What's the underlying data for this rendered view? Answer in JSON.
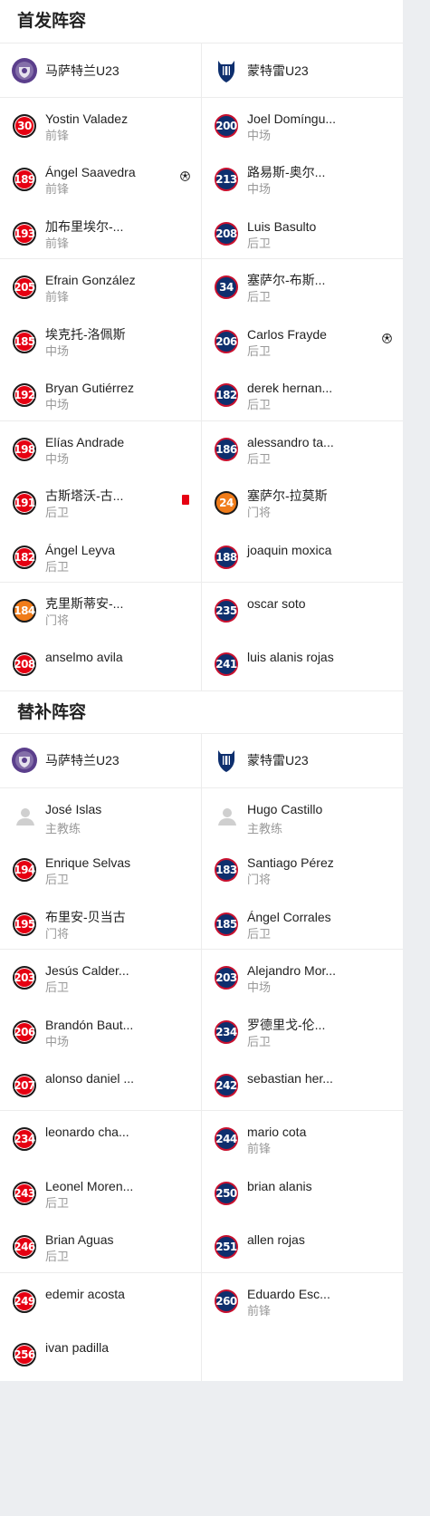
{
  "starting": {
    "title": "首发阵容",
    "home_team": "马萨特兰U23",
    "away_team": "蒙特雷U23",
    "home": [
      {
        "num": "30",
        "name": "Yostin Valadez",
        "pos": "前锋",
        "badge": "red"
      },
      {
        "num": "189",
        "name": "Ángel Saavedra",
        "pos": "前锋",
        "badge": "red",
        "event": "goal-icon"
      },
      {
        "num": "193",
        "name": "加布里埃尔-...",
        "pos": "前锋",
        "badge": "red"
      },
      {
        "num": "205",
        "name": "Efrain González",
        "pos": "前锋",
        "badge": "red"
      },
      {
        "num": "185",
        "name": "埃克托-洛佩斯",
        "pos": "中场",
        "badge": "red"
      },
      {
        "num": "192",
        "name": "Bryan Gutiérrez",
        "pos": "中场",
        "badge": "red"
      },
      {
        "num": "198",
        "name": "Elías Andrade",
        "pos": "中场",
        "badge": "red"
      },
      {
        "num": "191",
        "name": "古斯塔沃-古...",
        "pos": "后卫",
        "badge": "red",
        "event": "red-card-icon"
      },
      {
        "num": "182",
        "name": "Ángel Leyva",
        "pos": "后卫",
        "badge": "red"
      },
      {
        "num": "184",
        "name": "克里斯蒂安-...",
        "pos": "门将",
        "badge": "orange"
      },
      {
        "num": "208",
        "name": "anselmo avila",
        "pos": "",
        "badge": "red"
      }
    ],
    "away": [
      {
        "num": "200",
        "name": "Joel Domíngu...",
        "pos": "中场",
        "badge": "blue"
      },
      {
        "num": "213",
        "name": "路易斯-奥尔...",
        "pos": "中场",
        "badge": "blue"
      },
      {
        "num": "208",
        "name": "Luis Basulto",
        "pos": "后卫",
        "badge": "blue"
      },
      {
        "num": "34",
        "name": "塞萨尔-布斯...",
        "pos": "后卫",
        "badge": "blue"
      },
      {
        "num": "206",
        "name": "Carlos Frayde",
        "pos": "后卫",
        "badge": "blue",
        "event": "goal-icon"
      },
      {
        "num": "182",
        "name": "derek hernan...",
        "pos": "后卫",
        "badge": "blue"
      },
      {
        "num": "186",
        "name": "alessandro ta...",
        "pos": "后卫",
        "badge": "blue"
      },
      {
        "num": "24",
        "name": "塞萨尔-拉莫斯",
        "pos": "门将",
        "badge": "orange"
      },
      {
        "num": "188",
        "name": "joaquin moxica",
        "pos": "",
        "badge": "blue"
      },
      {
        "num": "235",
        "name": "oscar soto",
        "pos": "",
        "badge": "blue"
      },
      {
        "num": "241",
        "name": "luis alanis rojas",
        "pos": "",
        "badge": "blue"
      }
    ]
  },
  "subs": {
    "title": "替补阵容",
    "home_team": "马萨特兰U23",
    "away_team": "蒙特雷U23",
    "home_coach": {
      "name": "José Islas",
      "role": "主教练"
    },
    "away_coach": {
      "name": "Hugo Castillo",
      "role": "主教练"
    },
    "home": [
      {
        "num": "194",
        "name": "Enrique Selvas",
        "pos": "后卫",
        "badge": "red"
      },
      {
        "num": "195",
        "name": "布里安-贝当古",
        "pos": "门将",
        "badge": "red"
      },
      {
        "num": "203",
        "name": "Jesús Calder...",
        "pos": "后卫",
        "badge": "red"
      },
      {
        "num": "206",
        "name": "Brandón Baut...",
        "pos": "中场",
        "badge": "red"
      },
      {
        "num": "207",
        "name": "alonso daniel ...",
        "pos": "",
        "badge": "red"
      },
      {
        "num": "234",
        "name": "leonardo cha...",
        "pos": "",
        "badge": "red"
      },
      {
        "num": "243",
        "name": "Leonel Moren...",
        "pos": "后卫",
        "badge": "red"
      },
      {
        "num": "246",
        "name": "Brian Aguas",
        "pos": "后卫",
        "badge": "red"
      },
      {
        "num": "249",
        "name": "edemir acosta",
        "pos": "",
        "badge": "red"
      },
      {
        "num": "256",
        "name": "ivan padilla",
        "pos": "",
        "badge": "red"
      }
    ],
    "away": [
      {
        "num": "183",
        "name": "Santiago Pérez",
        "pos": "门将",
        "badge": "blue"
      },
      {
        "num": "185",
        "name": "Ángel Corrales",
        "pos": "后卫",
        "badge": "blue"
      },
      {
        "num": "203",
        "name": "Alejandro Mor...",
        "pos": "中场",
        "badge": "blue"
      },
      {
        "num": "234",
        "name": "罗德里戈-伦...",
        "pos": "后卫",
        "badge": "blue"
      },
      {
        "num": "242",
        "name": "sebastian her...",
        "pos": "",
        "badge": "blue"
      },
      {
        "num": "244",
        "name": "mario cota",
        "pos": "前锋",
        "badge": "blue"
      },
      {
        "num": "250",
        "name": "brian alanis",
        "pos": "",
        "badge": "blue"
      },
      {
        "num": "251",
        "name": "allen rojas",
        "pos": "",
        "badge": "blue"
      },
      {
        "num": "260",
        "name": "Eduardo Esc...",
        "pos": "前锋",
        "badge": "blue"
      }
    ]
  },
  "colors": {
    "home_badge": "#e60012",
    "away_badge": "#0e2f6e",
    "gk_badge": "#f07c1a",
    "divider": "#ececec",
    "background": "#eceef1"
  }
}
